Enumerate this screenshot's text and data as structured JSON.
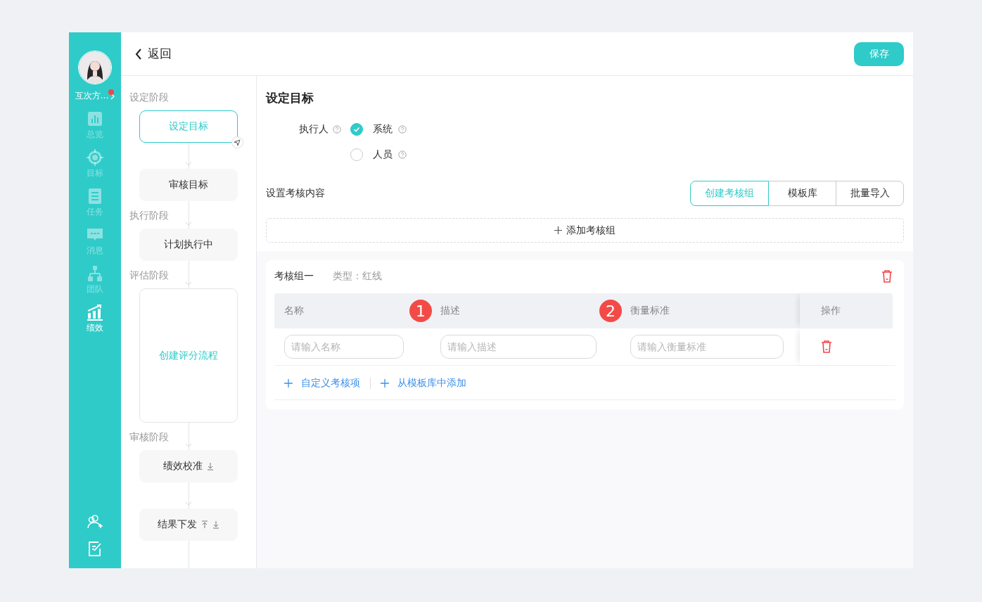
{
  "user": {
    "name": "互次方…",
    "notification": true
  },
  "nav": [
    {
      "label": "总览",
      "selected": false
    },
    {
      "label": "目标",
      "selected": false
    },
    {
      "label": "任务",
      "selected": false
    },
    {
      "label": "消息",
      "selected": false
    },
    {
      "label": "团队",
      "selected": false
    },
    {
      "label": "绩效",
      "selected": true
    }
  ],
  "header": {
    "back": "返回",
    "save": "保存"
  },
  "phases": [
    {
      "label": "设定阶段",
      "steps": [
        {
          "label": "设定目标",
          "kind": "step",
          "selected": true,
          "send": true
        },
        {
          "label": "审核目标",
          "kind": "step",
          "selected": false
        }
      ]
    },
    {
      "label": "执行阶段",
      "steps": [
        {
          "label": "计划执行中",
          "kind": "step",
          "selected": false
        }
      ]
    },
    {
      "label": "评估阶段",
      "steps": [
        {
          "label": "创建评分流程",
          "kind": "card"
        }
      ]
    },
    {
      "label": "审核阶段",
      "steps": [
        {
          "label": "绩效校准",
          "kind": "step",
          "selected": false,
          "move_down": true
        },
        {
          "label": "结果下发",
          "kind": "step",
          "selected": false,
          "move_up": true,
          "move_down": true
        }
      ]
    }
  ],
  "content": {
    "title": "设定目标",
    "executor": {
      "label": "执行人",
      "options": [
        {
          "label": "系统",
          "selected": true
        },
        {
          "label": "人员",
          "selected": false
        }
      ]
    },
    "section": "设置考核内容",
    "modes": [
      {
        "label": "创建考核组",
        "selected": true
      },
      {
        "label": "模板库",
        "selected": false
      },
      {
        "label": "批量导入",
        "selected": false
      }
    ],
    "add_group": "添加考核组",
    "group": {
      "title": "考核组一",
      "type": "类型：红线",
      "columns": [
        {
          "label": "名称"
        },
        {
          "label": "描述",
          "badge": "1"
        },
        {
          "label": "衡量标准",
          "badge": "2"
        },
        {
          "label": "操作"
        }
      ],
      "rows": [
        {
          "placeholders": [
            "请输入名称",
            "请输入描述",
            "请输入衡量标准"
          ]
        }
      ],
      "links": [
        "自定义考核项",
        "从模板库中添加"
      ]
    }
  }
}
